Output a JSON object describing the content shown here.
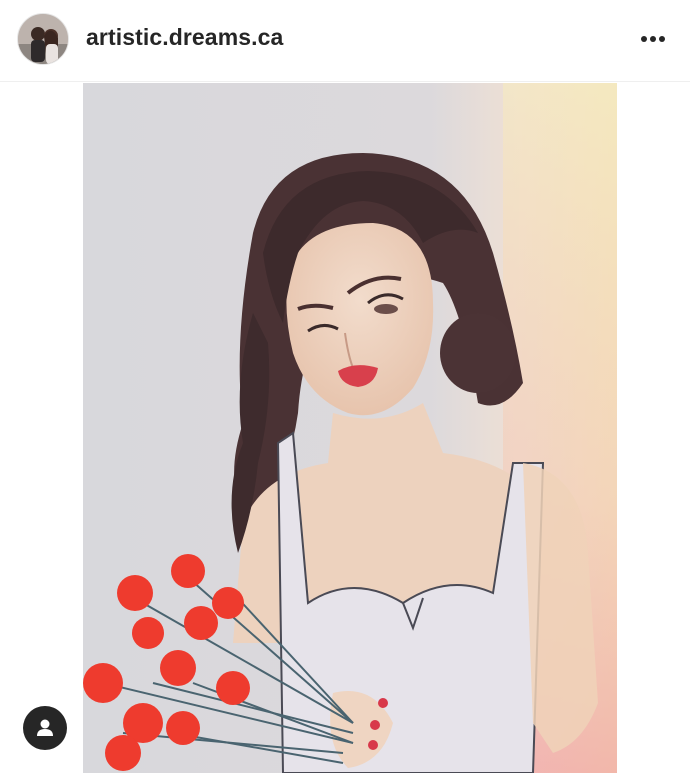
{
  "post": {
    "username": "artistic.dreams.ca"
  },
  "icons": {
    "more": "more-options-icon",
    "tag": "user-tag-icon"
  }
}
